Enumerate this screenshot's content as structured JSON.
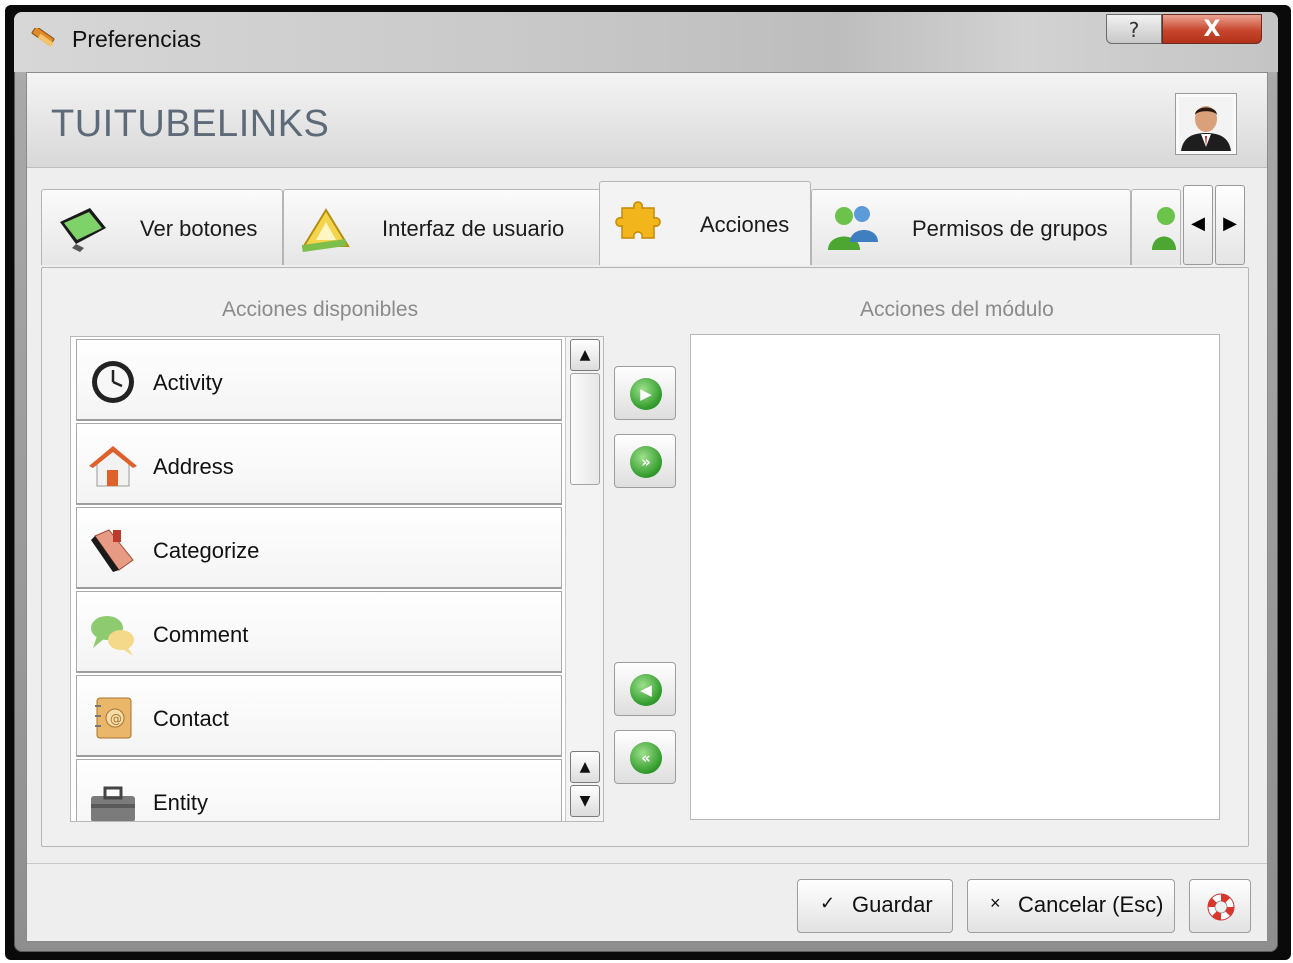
{
  "window": {
    "title": "Preferencias",
    "help_glyph": "?",
    "close_glyph": "X",
    "app_icon": "ruler-pencil-icon"
  },
  "header": {
    "app_name": "TUITUBELINKS",
    "avatar": "user-avatar"
  },
  "tabs": [
    {
      "label": "Ver botones",
      "icon": "monitor-icon",
      "active": false
    },
    {
      "label": "Interfaz de usuario",
      "icon": "drafting-tools-icon",
      "active": false
    },
    {
      "label": "Acciones",
      "icon": "puzzle-icon",
      "active": true
    },
    {
      "label": "Permisos de grupos",
      "icon": "users-group-icon",
      "active": false
    }
  ],
  "tab_scroll": {
    "left_glyph": "◀",
    "right_glyph": "▶"
  },
  "available": {
    "title": "Acciones disponibles",
    "items": [
      {
        "label": "Activity",
        "icon": "clock-icon"
      },
      {
        "label": "Address",
        "icon": "house-icon"
      },
      {
        "label": "Categorize",
        "icon": "book-icon"
      },
      {
        "label": "Comment",
        "icon": "speech-bubbles-icon"
      },
      {
        "label": "Contact",
        "icon": "address-book-icon"
      },
      {
        "label": "Entity",
        "icon": "briefcase-icon"
      }
    ]
  },
  "module": {
    "title": "Acciones del módulo",
    "items": []
  },
  "move_buttons": {
    "add_one": "▶",
    "add_all": "»",
    "remove_one": "◀",
    "remove_all": "«"
  },
  "scrollbar": {
    "up_glyph": "▲",
    "down_glyph": "▼"
  },
  "footer": {
    "save_label": "Guardar",
    "save_glyph": "✓",
    "cancel_label": "Cancelar (Esc)",
    "cancel_glyph": "×",
    "help_icon": "lifebuoy-icon"
  },
  "colors": {
    "accent_green": "#2f9a2a",
    "close_red": "#c9462e",
    "app_name": "#5f6a78"
  }
}
